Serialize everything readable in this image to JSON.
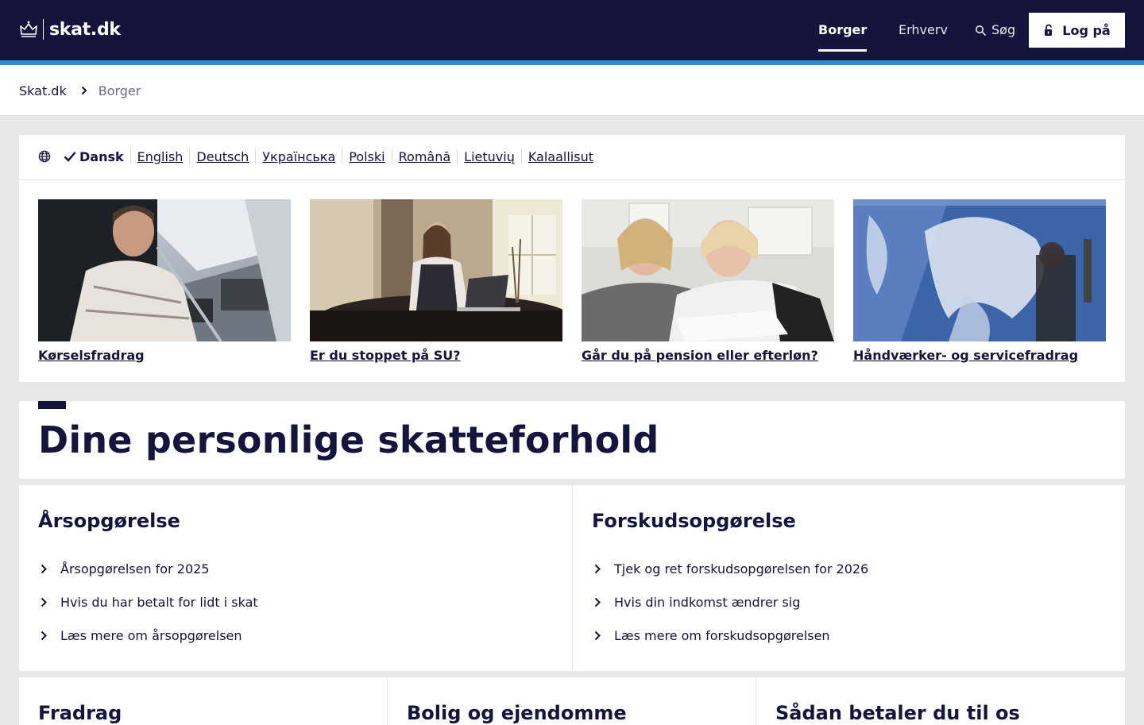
{
  "header": {
    "logo_text": "skat.dk",
    "nav": {
      "borger": "Borger",
      "erhverv": "Erhverv",
      "search": "Søg"
    },
    "login_label": "Log på"
  },
  "breadcrumb": {
    "home": "Skat.dk",
    "current": "Borger"
  },
  "languages": {
    "active": "Dansk",
    "links": [
      "English",
      "Deutsch",
      "Українська",
      "Polski",
      "Română",
      "Lietuvių",
      "Kalaallisut"
    ]
  },
  "cards": [
    {
      "title": "Kørselsfradrag"
    },
    {
      "title": "Er du stoppet på SU?"
    },
    {
      "title": "Går du på pension eller efterløn?"
    },
    {
      "title": "Håndværker- og servicefradrag"
    }
  ],
  "section_title": "Dine personlige skatteforhold",
  "boxes": {
    "arsopgorelse": {
      "title": "Årsopgørelse",
      "links": [
        "Årsopgørelsen for 2025",
        "Hvis du har betalt for lidt i skat",
        "Læs mere om årsopgørelsen"
      ]
    },
    "forskudsopgorelse": {
      "title": "Forskudsopgørelse",
      "links": [
        "Tjek og ret forskudsopgørelsen for 2026",
        "Hvis din indkomst ændrer sig",
        "Læs mere om forskudsopgørelsen"
      ]
    },
    "fradrag": {
      "title": "Fradrag"
    },
    "bolig": {
      "title": "Bolig og ejendomme"
    },
    "betal": {
      "title": "Sådan betaler du til os"
    }
  },
  "colors": {
    "navy": "#14143c",
    "accent_blue": "#2b8fd6",
    "page_bg": "#e8e8e8"
  },
  "icons": [
    "crown-icon",
    "search-icon",
    "lock-icon",
    "chevron-right-icon",
    "globe-icon",
    "check-icon"
  ]
}
